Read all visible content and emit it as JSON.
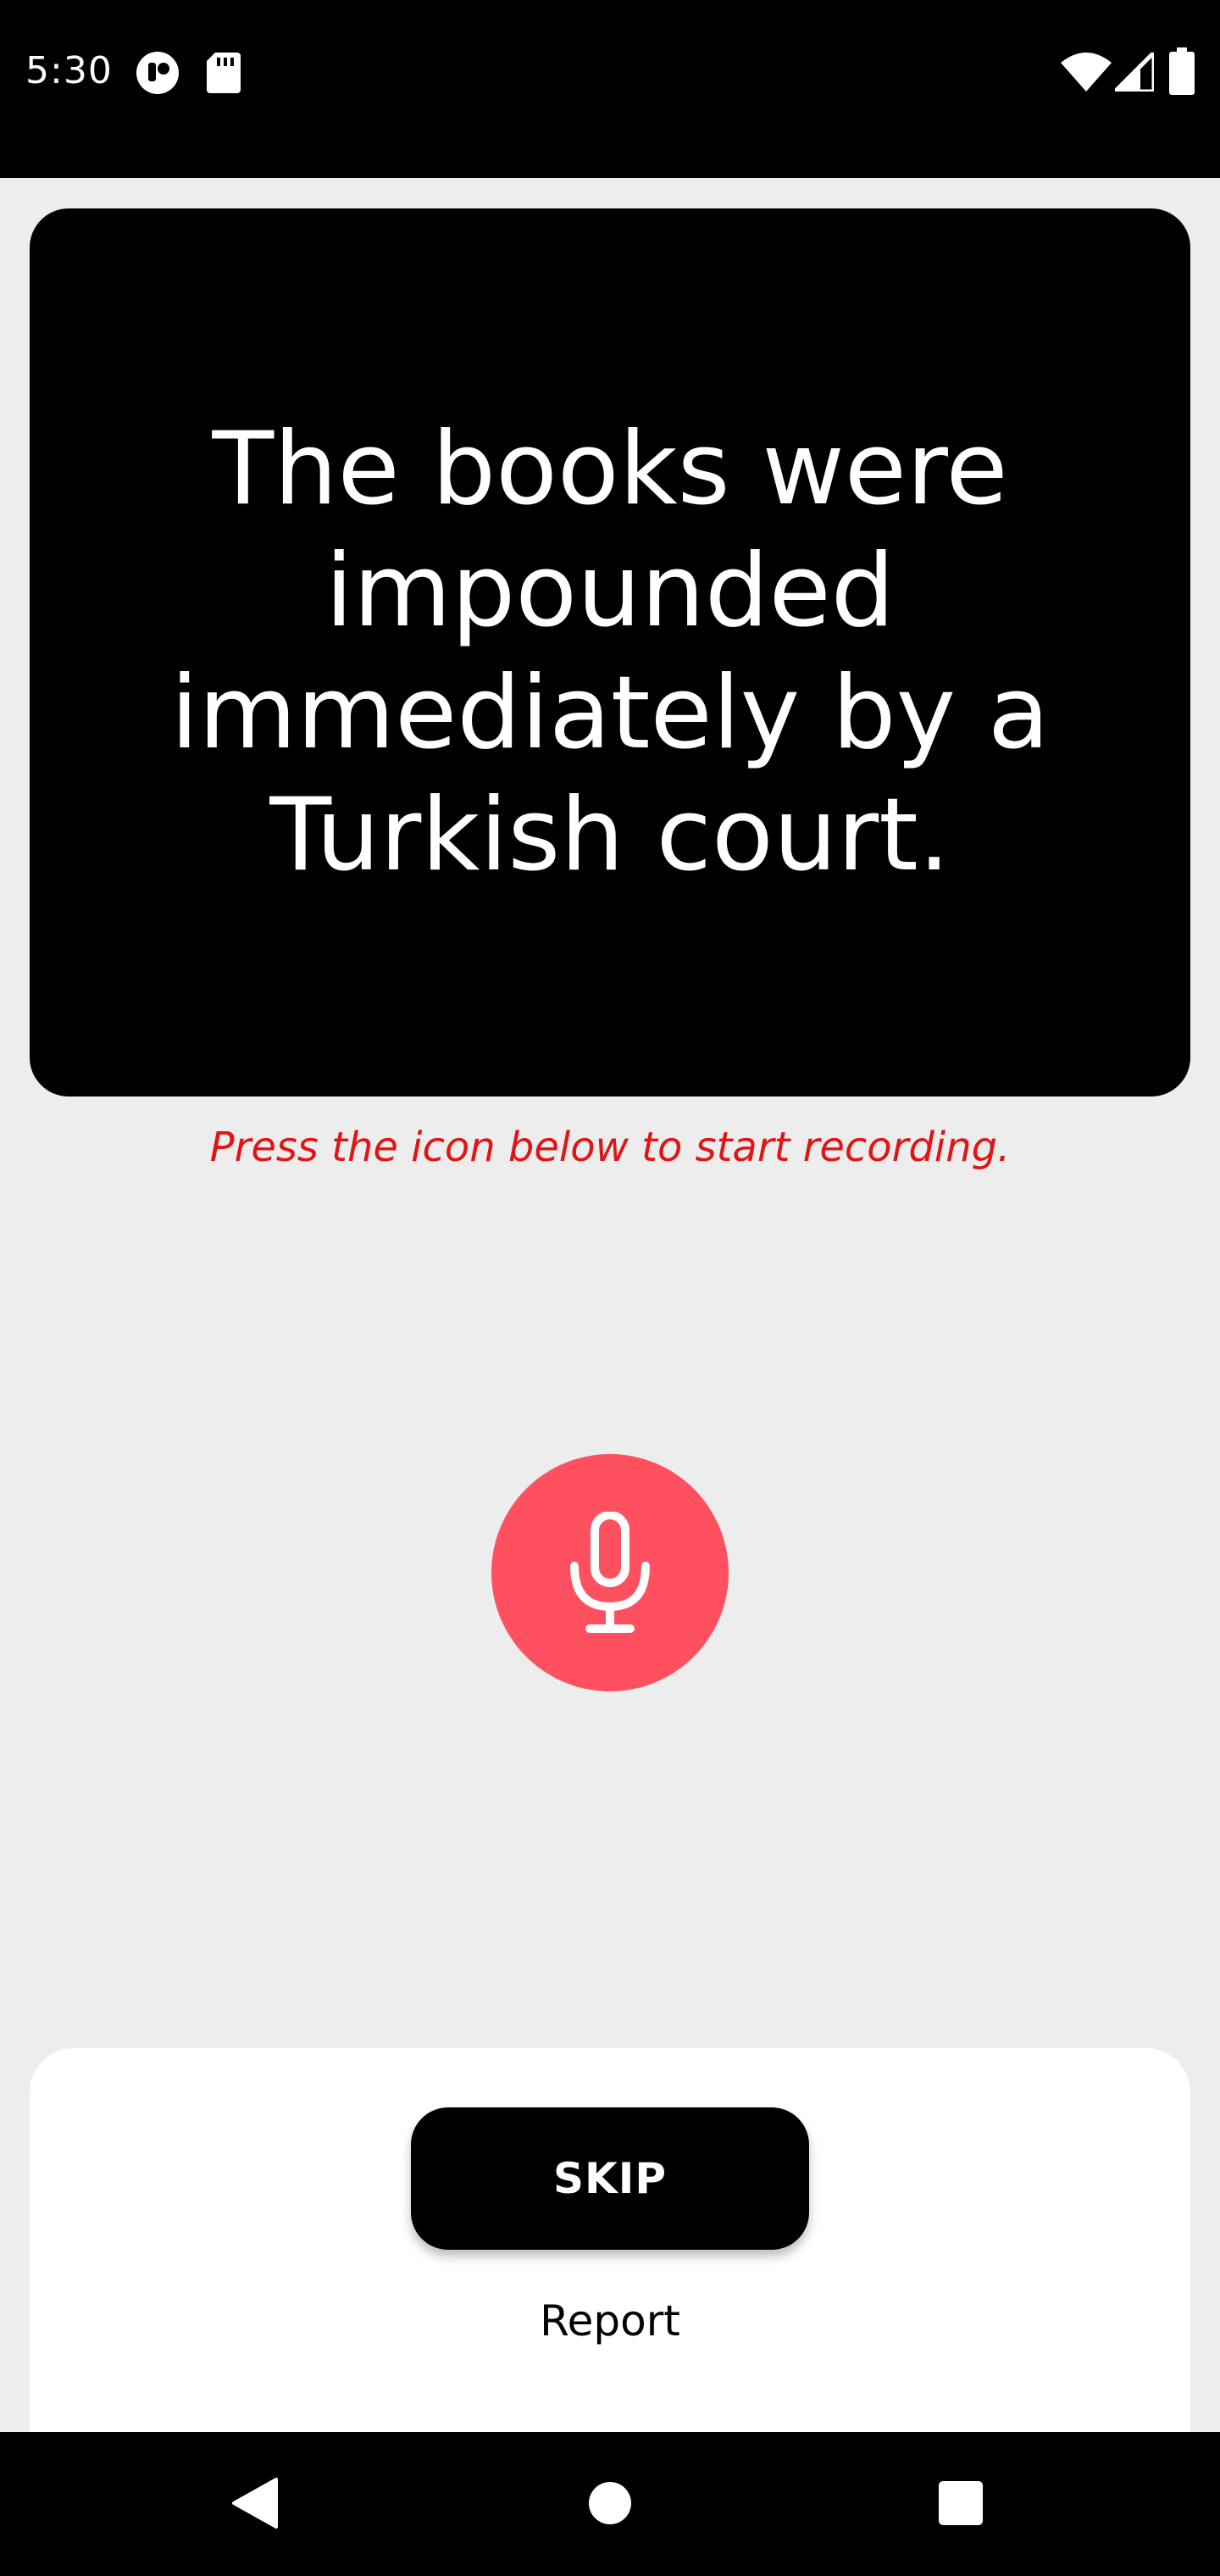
{
  "status_bar": {
    "time": "5:30",
    "left_icons": [
      "notification-app-icon",
      "sd-card-icon"
    ],
    "right_icons": [
      "wifi-icon",
      "cell-signal-icon",
      "battery-icon"
    ]
  },
  "card": {
    "sentence": "The books were impounded immediately by a Turkish court."
  },
  "hint": {
    "text": "Press the icon below to start recording."
  },
  "mic": {
    "icon": "microphone-icon",
    "color": "#ff5060"
  },
  "actions": {
    "skip_label": "SKIP",
    "report_label": "Report"
  },
  "nav": {
    "icons": [
      "back-icon",
      "home-icon",
      "recents-icon"
    ]
  },
  "colors": {
    "accent": "#ff5060",
    "hint": "#e01515",
    "background": "#ededed"
  }
}
